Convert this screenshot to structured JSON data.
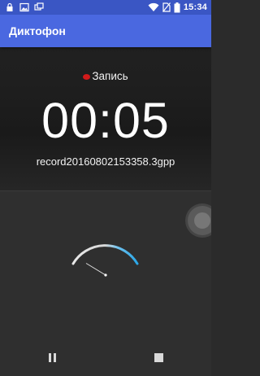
{
  "status_bar": {
    "time": "15:34",
    "left_icons": [
      "lock-icon",
      "image-icon",
      "screens-icon"
    ],
    "right_icons": [
      "wifi-icon",
      "no-sim-icon",
      "battery-icon"
    ]
  },
  "app_bar": {
    "title": "Диктофон"
  },
  "recording": {
    "state_label": "Запись",
    "elapsed": "00:05",
    "filename": "record20160802153358.3gpp"
  },
  "level_meter": {
    "icon": "vu-meter-icon",
    "level": 0.08
  },
  "controls": {
    "pause_icon": "pause-icon",
    "stop_icon": "stop-icon"
  },
  "colors": {
    "status_bar": "#3a56c4",
    "app_bar": "#4a68e0",
    "record_dot": "#d11a1a",
    "meter_arc": "#2aa7e8"
  }
}
